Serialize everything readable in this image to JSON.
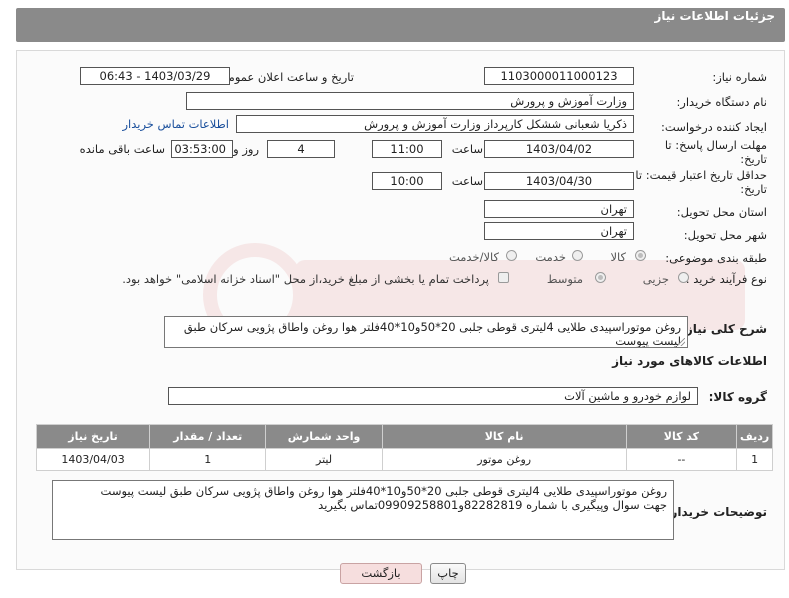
{
  "header": {
    "title": "جزئیات اطلاعات نیاز"
  },
  "fields": {
    "need_number": {
      "label": "شماره نیاز:",
      "value": "1103000011000123"
    },
    "announce_datetime": {
      "label": "تاریخ و ساعت اعلان عمومی:",
      "value": "1403/03/29 - 06:43"
    },
    "buyer_org": {
      "label": "نام دستگاه خریدار:",
      "value": "وزارت آموزش و پرورش"
    },
    "requester": {
      "label": "ایجاد کننده درخواست:",
      "value": "ذکریا شعبانی ششکل کارپرداز وزارت آموزش و پرورش",
      "link": "اطلاعات تماس خریدار"
    },
    "deadline": {
      "label": "مهلت ارسال پاسخ: تا",
      "label2": "تاریخ:",
      "date": "1403/04/02",
      "time_label": "ساعت",
      "time": "11:00",
      "days": "4",
      "days_label": "روز و",
      "remaining": "03:53:00",
      "remaining_label": "ساعت باقی مانده"
    },
    "price_validity": {
      "label": "حداقل تاریخ اعتبار قیمت: تا",
      "label2": "تاریخ:",
      "date": "1403/04/30",
      "time_label": "ساعت",
      "time": "10:00"
    },
    "province": {
      "label": "استان محل تحویل:",
      "value": "تهران"
    },
    "city": {
      "label": "شهر محل تحویل:",
      "value": "تهران"
    },
    "category": {
      "label": "طبقه بندی موضوعی:",
      "options": [
        "کالا",
        "خدمت",
        "کالا/خدمت"
      ],
      "selected": "کالا"
    },
    "purchase_type": {
      "label": "نوع فرآیند خرید :",
      "options": [
        "جزیی",
        "متوسط"
      ],
      "selected": "متوسط",
      "payment_note": "پرداخت تمام یا بخشی از مبلغ خرید،از محل \"اسناد خزانه اسلامی\" خواهد بود."
    },
    "description": {
      "label": "شرح کلی نیاز:",
      "value": "روغن موتوراسپیدی طلایی 4لیتری قوطی جلبی 20*50و10*40فلتر هوا روغن واطاق پژویی سرکان طبق لیست پیوست"
    }
  },
  "goods_section": {
    "title": "اطلاعات کالاهای مورد نیاز"
  },
  "goods_group": {
    "label": "گروه کالا:",
    "value": "لوازم خودرو و ماشین آلات"
  },
  "goods_table": {
    "headers": [
      "ردیف",
      "کد کالا",
      "نام کالا",
      "واحد شمارش",
      "تعداد / مقدار",
      "تاریخ نیاز"
    ],
    "rows": [
      [
        "1",
        "--",
        "روغن موتور",
        "لیتر",
        "1",
        "1403/04/03"
      ]
    ]
  },
  "buyer_notes": {
    "label": "توضیحات خریدار:",
    "line1": "روغن موتوراسپیدی طلایی 4لیتری قوطی جلبی 20*50و10*40فلتر هوا روغن واطاق پژویی سرکان طبق لیست پیوست",
    "line2": "جهت سوال وپیگیری با شماره 82282819و09909258801تماس بگیرید"
  },
  "buttons": {
    "print": "چاپ",
    "back": "بازگشت"
  },
  "colors": {
    "header_bg": "#8a8a8a",
    "link": "#1a4f9c",
    "back_button_bg": "#f6dede"
  }
}
